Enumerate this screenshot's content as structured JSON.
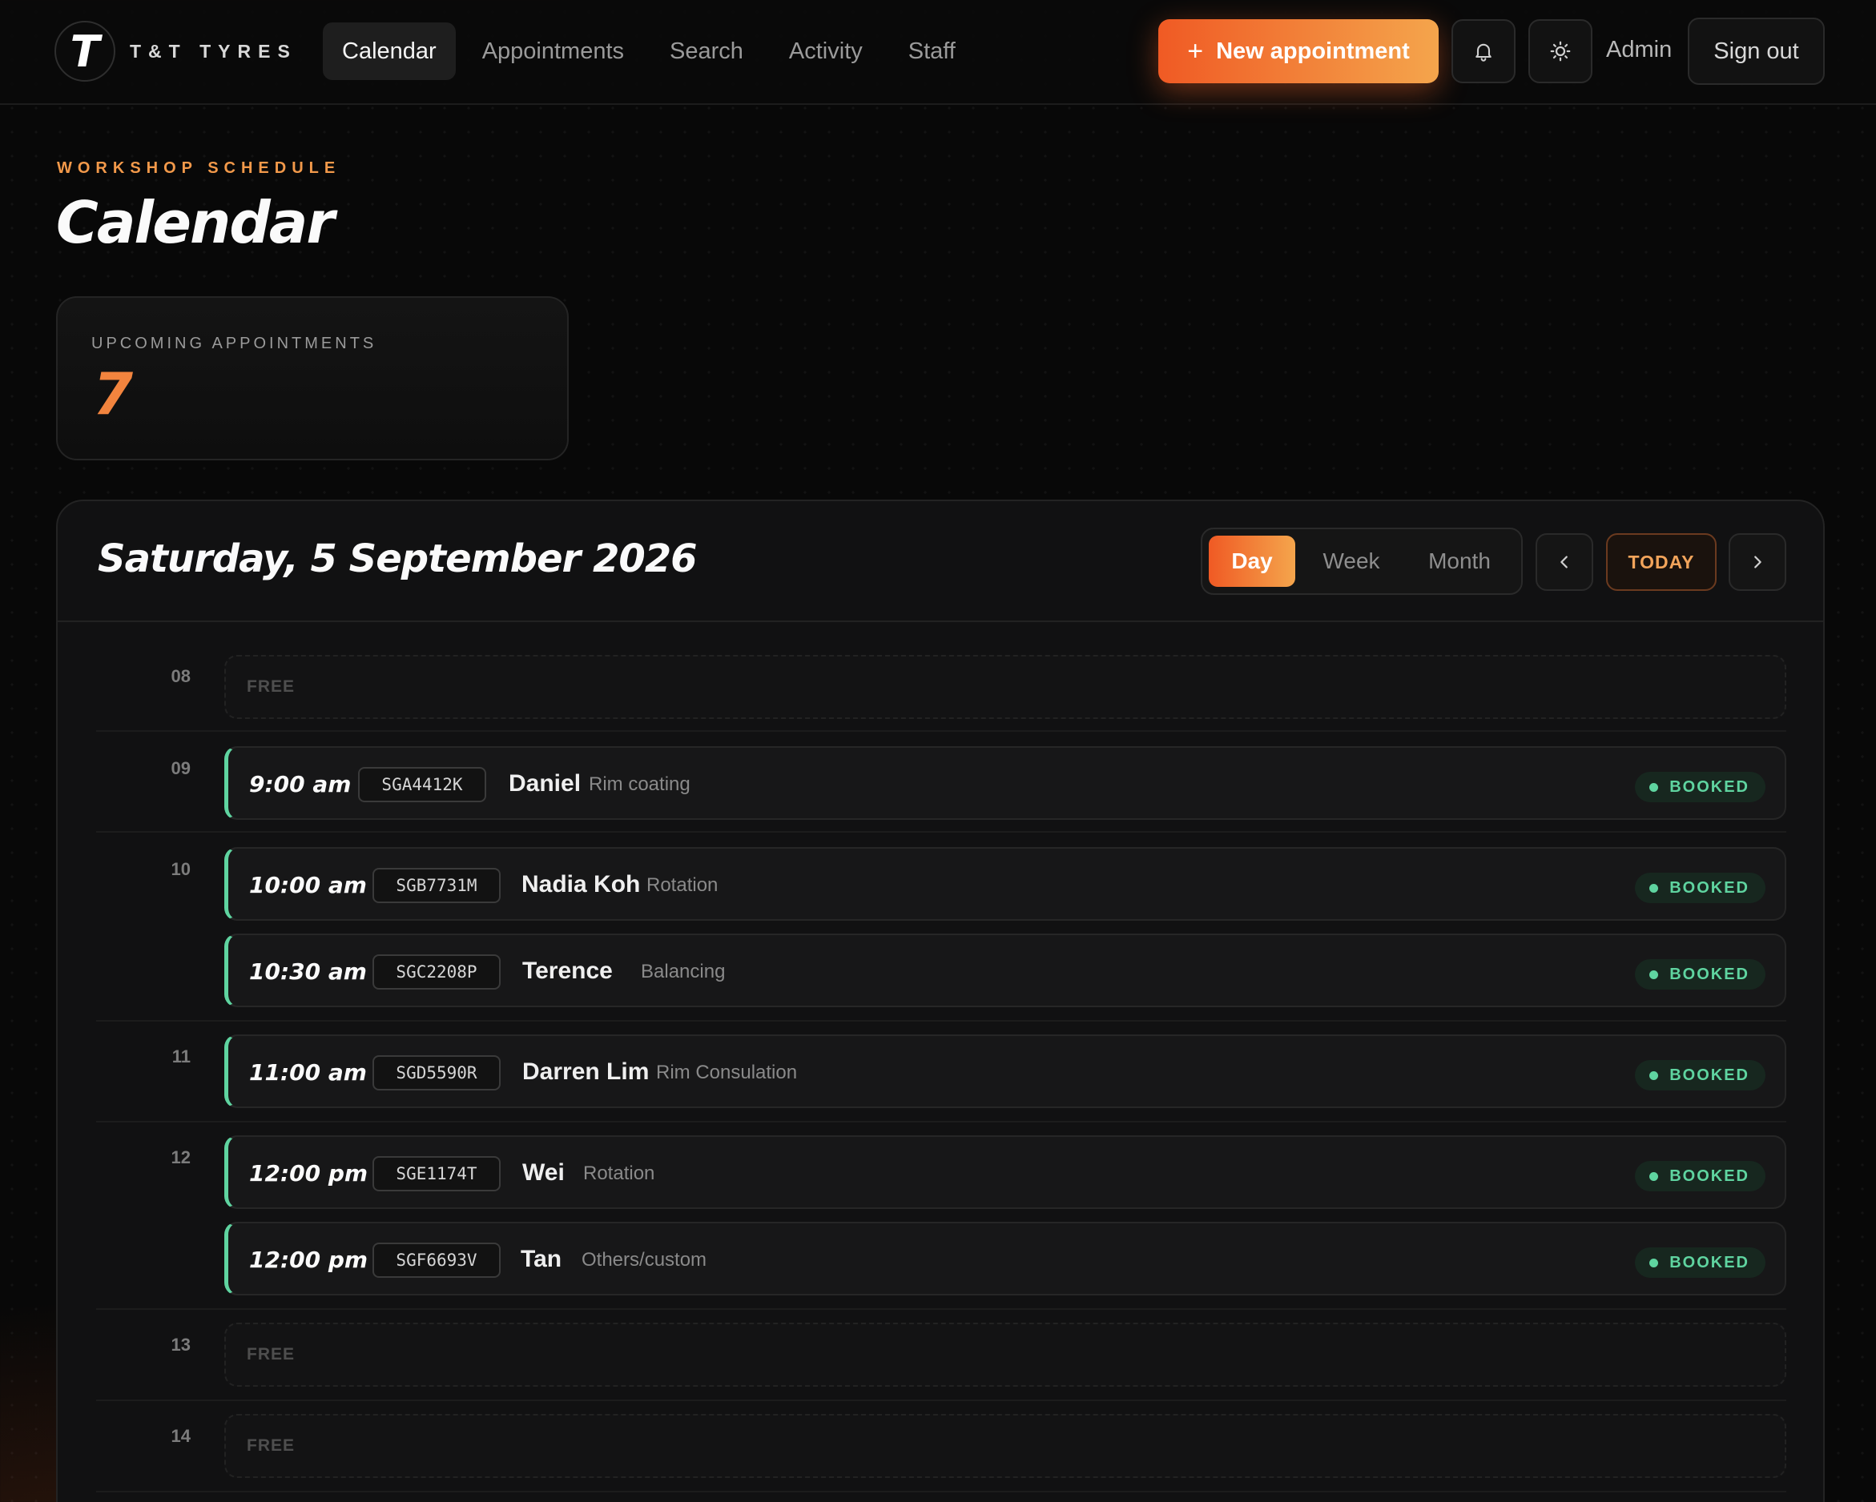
{
  "brand": {
    "name": "T&T TYRES",
    "logo_letter": "T"
  },
  "nav": {
    "items": [
      {
        "label": "Calendar",
        "active": true
      },
      {
        "label": "Appointments"
      },
      {
        "label": "Search"
      },
      {
        "label": "Activity"
      },
      {
        "label": "Staff"
      }
    ]
  },
  "header_actions": {
    "new_appointment_label": "New appointment",
    "notifications_icon": "bell-icon",
    "theme_icon": "sun-icon",
    "user_label": "Admin",
    "sign_out_label": "Sign out"
  },
  "page": {
    "eyebrow": "WORKSHOP SCHEDULE",
    "title": "Calendar"
  },
  "stats": {
    "label": "UPCOMING APPOINTMENTS",
    "value": "7"
  },
  "calendar": {
    "date_title": "Saturday, 5 September 2026",
    "views": [
      {
        "label": "Day",
        "active": true
      },
      {
        "label": "Week"
      },
      {
        "label": "Month"
      }
    ],
    "today_label": "TODAY",
    "prev_icon": "chevron-left-icon",
    "next_icon": "chevron-right-icon",
    "free_label": "FREE",
    "hours": [
      {
        "hour": "08",
        "appointments": []
      },
      {
        "hour": "09",
        "appointments": [
          {
            "time": "9:00 am",
            "plate": "SGA4412K",
            "name": "Daniel",
            "service": "Rim coating",
            "status": "BOOKED"
          }
        ]
      },
      {
        "hour": "10",
        "appointments": [
          {
            "time": "10:00 am",
            "plate": "SGB7731M",
            "name": "Nadia Koh",
            "service": "Rotation",
            "status": "BOOKED"
          },
          {
            "time": "10:30 am",
            "plate": "SGC2208P",
            "name": "Terence",
            "service": "Balancing",
            "status": "BOOKED"
          }
        ]
      },
      {
        "hour": "11",
        "appointments": [
          {
            "time": "11:00 am",
            "plate": "SGD5590R",
            "name": "Darren Lim",
            "service": "Rim Consulation",
            "status": "BOOKED"
          }
        ]
      },
      {
        "hour": "12",
        "appointments": [
          {
            "time": "12:00 pm",
            "plate": "SGE1174T",
            "name": "Wei",
            "service": "Rotation",
            "status": "BOOKED"
          },
          {
            "time": "12:00 pm",
            "plate": "SGF6693V",
            "name": "Tan",
            "service": "Others/custom",
            "status": "BOOKED"
          }
        ]
      },
      {
        "hour": "13",
        "appointments": []
      },
      {
        "hour": "14",
        "appointments": []
      }
    ]
  },
  "colors": {
    "accent": "#f05a24",
    "accent_light": "#f4a54c",
    "booked": "#5fd4a0"
  }
}
